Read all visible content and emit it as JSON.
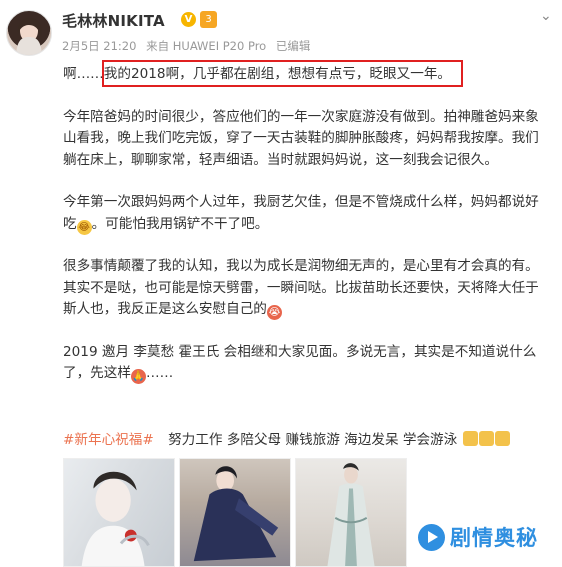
{
  "header": {
    "username": "毛林林NIKITA",
    "verified_badge": "V",
    "level_badge": "3",
    "meta": {
      "date": "2月5日 21:20",
      "source": "来自 HUAWEI P20 Pro",
      "edited": "已编辑"
    },
    "avatar_icon": "avatar-photo",
    "menu_icon": "chevron-down-icon"
  },
  "post": {
    "paragraphs": [
      {
        "lines": [
          "啊……我的2018啊，几乎都在剧组，想想有点亏，眨眼又一年。"
        ]
      },
      {
        "lines": [
          "今年陪爸妈的时间很少，答应他们的一年一次家庭游没有做到。拍神雕爸妈来象",
          "山看我，晚上我们吃完饭，穿了一天古装鞋的脚肿胀酸疼，妈妈帮我按摩。我们",
          "躺在床上，聊聊家常，轻声细语。当时就跟妈妈说，这一刻我会记很久。"
        ]
      },
      {
        "lines": [
          "今年第一次跟妈妈两个人过年，我厨艺欠佳，但是不管烧成什么样，妈妈都说好",
          "吃",
          "。可能怕我用锅铲不干了吧。"
        ]
      },
      {
        "lines": [
          "很多事情颠覆了我的认知，我以为成长是润物细无声的，是心里有才会真的有。",
          "其实不是哒，也可能是惊天劈雷，一瞬间哒。比拔苗助长还要快，天将降大任于",
          "斯人也，我反正是这么安慰自己的"
        ]
      },
      {
        "lines": [
          "2019 邀月 李莫愁 霍王氏 会相继和大家见面。多说无言，其实是不知道说什么",
          "了，先这样",
          "……"
        ]
      }
    ],
    "emoji": {
      "laugh": "😂",
      "cry": "😭",
      "bow": "🙏"
    }
  },
  "tags": {
    "topic": "#新年心祝福#",
    "wishes": "努力工作 多陪父母 赚钱旅游 海边发呆 学会游泳"
  },
  "watermark": {
    "text": "剧情奥秘",
    "icon": "play-circle-icon"
  },
  "colors": {
    "link": "#eb7350",
    "highlight_border": "#e02020",
    "watermark": "#2f8fe0",
    "vip_badge": "#f7b500"
  }
}
